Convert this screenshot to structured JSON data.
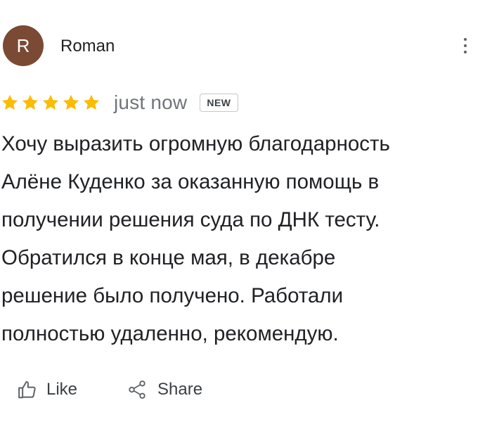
{
  "review": {
    "author": {
      "initial": "R",
      "name": "Roman",
      "avatar_color": "#7a4a35"
    },
    "rating": {
      "value": 5,
      "max": 5,
      "star_color": "#fbbc04"
    },
    "time": "just now",
    "badge": "NEW",
    "text": "Хочу выразить огромную благодарность\nАлёне Куденко за оказанную помощь в\nполучении решения суда по ДНК тесту.\nОбратился в конце мая, в декабре\nрешение было получено. Работали\nполностью удаленно, рекомендую.",
    "more_icon": "more-vert-icon"
  },
  "actions": {
    "like_label": "Like",
    "like_icon": "thumb-up-icon",
    "share_label": "Share",
    "share_icon": "share-icon"
  }
}
